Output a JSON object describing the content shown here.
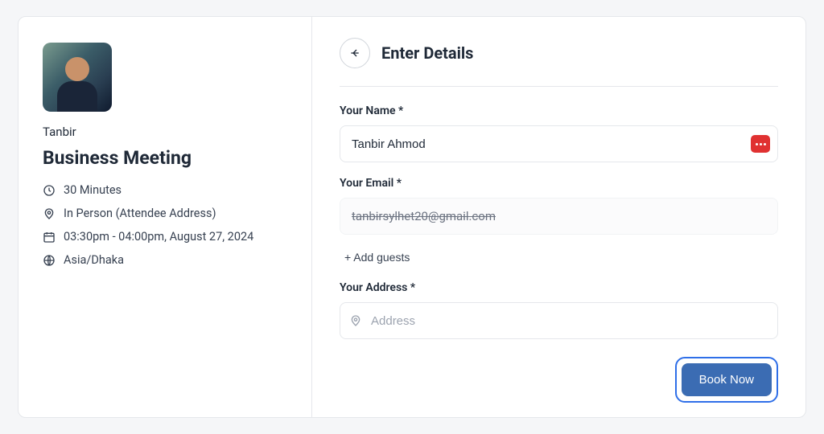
{
  "left": {
    "host_name": "Tanbir",
    "meeting_title": "Business Meeting",
    "duration": "30 Minutes",
    "location": "In Person (Attendee Address)",
    "datetime": "03:30pm - 04:00pm, August 27, 2024",
    "timezone": "Asia/Dhaka"
  },
  "right": {
    "title": "Enter Details",
    "name_label": "Your Name *",
    "name_value": "Tanbir Ahmod",
    "email_label": "Your Email *",
    "email_value": "tanbirsylhet20@gmail.com",
    "add_guests_label": "+ Add guests",
    "address_label": "Your Address *",
    "address_placeholder": "Address",
    "book_button_label": "Book Now"
  }
}
